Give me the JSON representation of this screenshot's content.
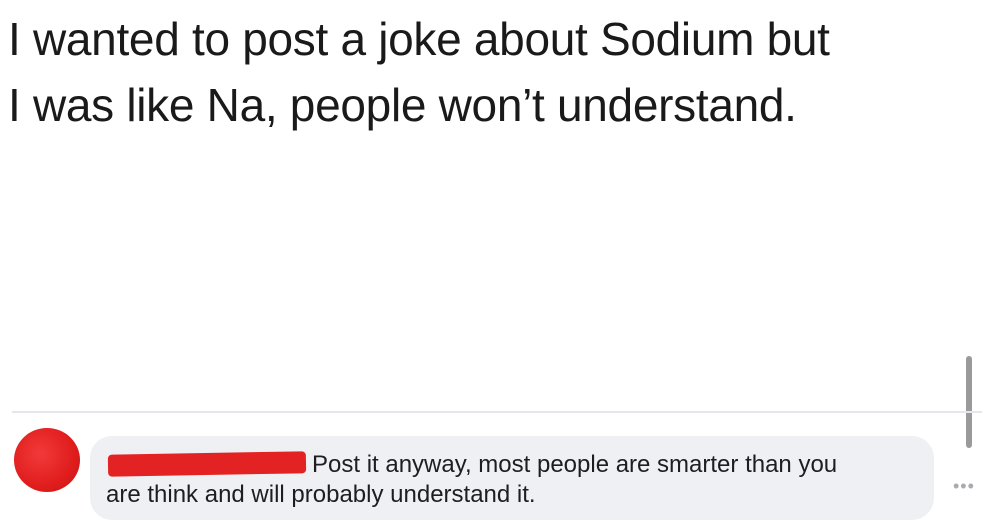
{
  "post": {
    "text_line1": "I wanted to post a joke about Sodium but",
    "text_line2": "I was like Na, people won’t understand."
  },
  "comment": {
    "text_line1": "Post it anyway, most people are smarter than you",
    "text_line2": "are think and will probably understand it.",
    "more_label": "•••"
  },
  "colors": {
    "redaction": "#e32323",
    "bubble": "#eef0f3"
  }
}
